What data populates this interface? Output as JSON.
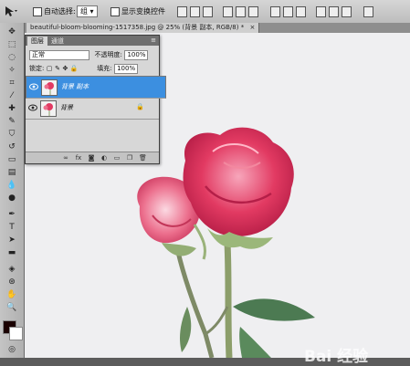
{
  "options_bar": {
    "auto_select_label": "自动选择:",
    "auto_select_value": "组",
    "show_transform_label": "显示变换控件"
  },
  "document_tab": {
    "title": "beautiful-bloom-blooming-1517358.jpg @ 25% (背景 副本, RGB/8) *"
  },
  "layers_panel": {
    "tabs": [
      "图层",
      "通道"
    ],
    "blend_mode": "正常",
    "opacity_label": "不透明度:",
    "opacity_value": "100%",
    "lock_label": "锁定:",
    "fill_label": "填充:",
    "fill_value": "100%",
    "layers": [
      {
        "name": "背景 副本",
        "selected": true
      },
      {
        "name": "背景",
        "selected": false
      }
    ]
  },
  "watermark": {
    "text": "Bai 经验"
  },
  "colors": {
    "selected_layer": "#3c8fe0",
    "rose": "#e23a62",
    "stem": "#8c9e6a"
  }
}
